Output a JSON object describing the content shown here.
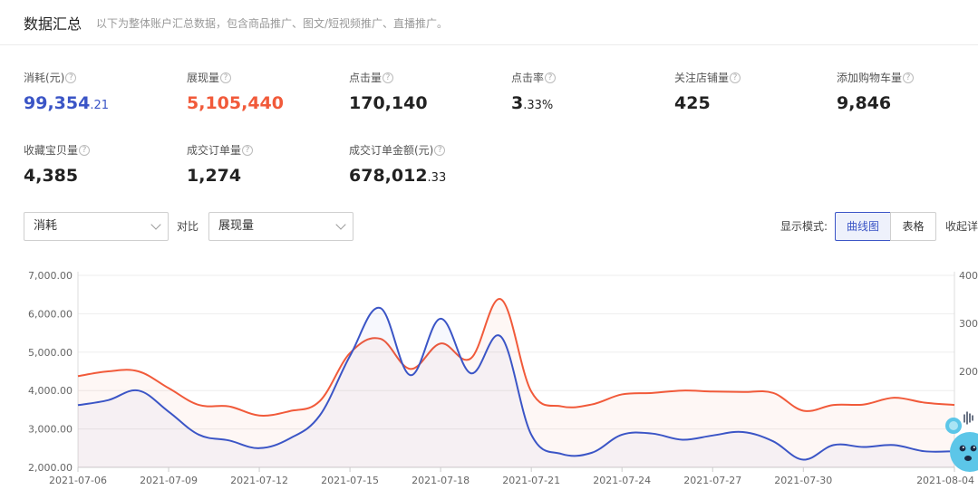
{
  "header": {
    "title": "数据汇总",
    "subtitle": "以下为整体账户汇总数据，包含商品推广、图文/短视频推广、直播推广。"
  },
  "metrics": [
    {
      "label": "消耗(元)",
      "int": "99,354",
      "dec": ".21",
      "color": "#3b55c6"
    },
    {
      "label": "展现量",
      "int": "5,105,440",
      "dec": "",
      "color": "#f15a3a"
    },
    {
      "label": "点击量",
      "int": "170,140",
      "dec": ""
    },
    {
      "label": "点击率",
      "int": "3",
      "dec": ".33%"
    },
    {
      "label": "关注店铺量",
      "int": "425",
      "dec": ""
    },
    {
      "label": "添加购物车量",
      "int": "9,846",
      "dec": ""
    },
    {
      "label": "收藏宝贝量",
      "int": "4,385",
      "dec": ""
    },
    {
      "label": "成交订单量",
      "int": "1,274",
      "dec": ""
    },
    {
      "label": "成交订单金额(元)",
      "int": "678,012",
      "dec": ".33"
    }
  ],
  "help_glyph": "?",
  "controls": {
    "primary_select": "消耗",
    "compare_label": "对比",
    "compare_select": "展现量",
    "mode_label": "显示模式:",
    "mode_chart": "曲线图",
    "mode_table": "表格",
    "collapse": "收起详"
  },
  "chart_data": {
    "type": "line",
    "x": [
      "2021-07-06",
      "2021-07-07",
      "2021-07-08",
      "2021-07-09",
      "2021-07-10",
      "2021-07-11",
      "2021-07-12",
      "2021-07-13",
      "2021-07-14",
      "2021-07-15",
      "2021-07-16",
      "2021-07-17",
      "2021-07-18",
      "2021-07-19",
      "2021-07-20",
      "2021-07-21",
      "2021-07-22",
      "2021-07-23",
      "2021-07-24",
      "2021-07-25",
      "2021-07-26",
      "2021-07-27",
      "2021-07-28",
      "2021-07-29",
      "2021-07-30",
      "2021-07-31",
      "2021-08-01",
      "2021-08-02",
      "2021-08-03",
      "2021-08-04"
    ],
    "x_tick_labels": [
      "2021-07-06",
      "2021-07-09",
      "2021-07-12",
      "2021-07-15",
      "2021-07-18",
      "2021-07-21",
      "2021-07-24",
      "2021-07-27",
      "2021-07-30",
      "2021-08-04"
    ],
    "y_left": {
      "ticks": [
        "2,000.00",
        "3,000.00",
        "4,000.00",
        "5,000.00",
        "6,000.00",
        "7,000.00"
      ],
      "min": 2000,
      "max": 7000
    },
    "y_right": {
      "ticks": [
        "400",
        "300",
        "200"
      ],
      "min": 0,
      "max": 400
    },
    "grid": true,
    "series": [
      {
        "name": "消耗",
        "axis": "left",
        "color": "#3b55c6",
        "values": [
          3620,
          3750,
          4000,
          3450,
          2850,
          2700,
          2500,
          2750,
          3350,
          4900,
          6150,
          4400,
          5870,
          4450,
          5400,
          2850,
          2350,
          2380,
          2850,
          2880,
          2720,
          2830,
          2920,
          2680,
          2200,
          2580,
          2530,
          2580,
          2420,
          2420
        ]
      },
      {
        "name": "展现量",
        "axis": "right",
        "color": "#f15a3a",
        "values": [
          190,
          200,
          200,
          165,
          130,
          127,
          108,
          117,
          138,
          238,
          268,
          205,
          258,
          227,
          350,
          158,
          127,
          131,
          152,
          155,
          160,
          158,
          157,
          155,
          118,
          130,
          131,
          145,
          135,
          130
        ]
      }
    ]
  }
}
